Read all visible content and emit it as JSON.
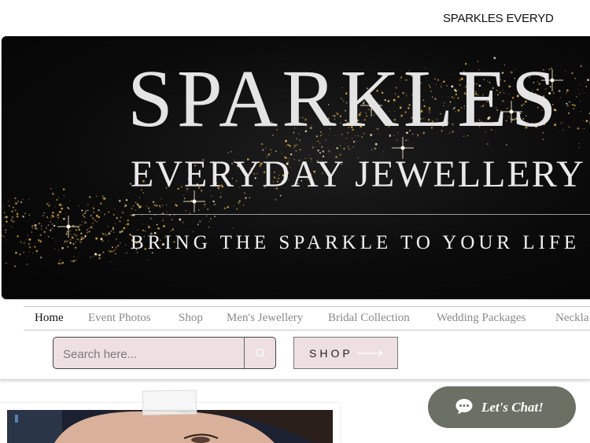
{
  "header": {
    "brand": "SPARKLES EVERYD"
  },
  "banner": {
    "title": "SPARKLES",
    "subtitle": "EVERYDAY JEWELLERY",
    "tagline": "BRING THE SPARKLE TO YOUR LIFE"
  },
  "nav": {
    "items": [
      {
        "label": "Home",
        "active": true
      },
      {
        "label": "Event Photos"
      },
      {
        "label": "Shop"
      },
      {
        "label": "Men's Jewellery"
      },
      {
        "label": "Bridal Collection"
      },
      {
        "label": "Wedding Packages"
      },
      {
        "label": "Neckla"
      }
    ]
  },
  "search": {
    "placeholder": "Search here..."
  },
  "shop_button": {
    "label": "SHOP"
  },
  "chat": {
    "label": "Let's Chat!"
  },
  "colors": {
    "accent_pink": "#eedfe3",
    "chat_bg": "#6b7064",
    "gold": "#d9a441"
  },
  "icons": [
    "search-icon",
    "arrow-right-icon",
    "chat-bubble-icon"
  ]
}
